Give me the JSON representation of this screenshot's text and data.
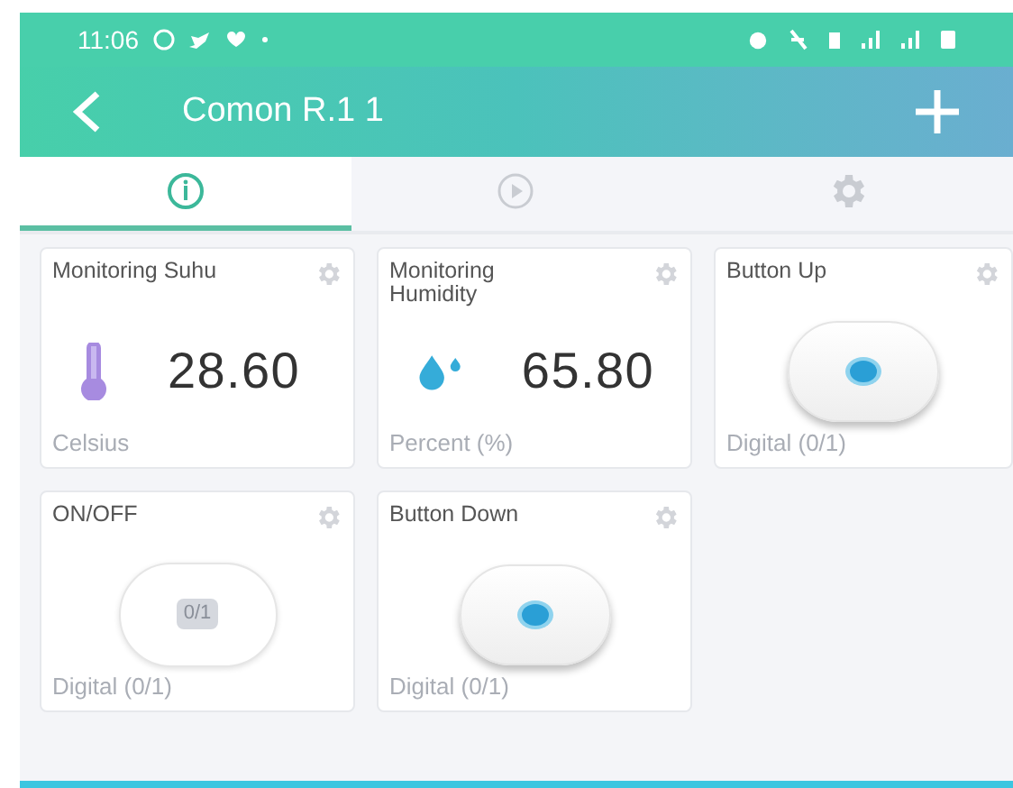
{
  "status_bar": {
    "time": "11:06"
  },
  "header": {
    "title": "Comon R.1 1"
  },
  "tabs": [
    {
      "kind": "dashboard",
      "selected": true
    },
    {
      "kind": "play",
      "selected": false
    },
    {
      "kind": "settings",
      "selected": false
    }
  ],
  "widgets": [
    {
      "kind": "temperature",
      "title": "Monitoring Suhu",
      "value": "28.60",
      "unit": "Celsius"
    },
    {
      "kind": "humidity",
      "title": "Monitoring Humidity",
      "value": "65.80",
      "unit": "Percent (%)"
    },
    {
      "kind": "button",
      "title": "Button Up",
      "unit": "Digital (0/1)"
    },
    {
      "kind": "switch",
      "title": "ON/OFF",
      "switch_label": "0/1",
      "unit": "Digital (0/1)"
    },
    {
      "kind": "button",
      "title": "Button Down",
      "unit": "Digital (0/1)"
    }
  ]
}
